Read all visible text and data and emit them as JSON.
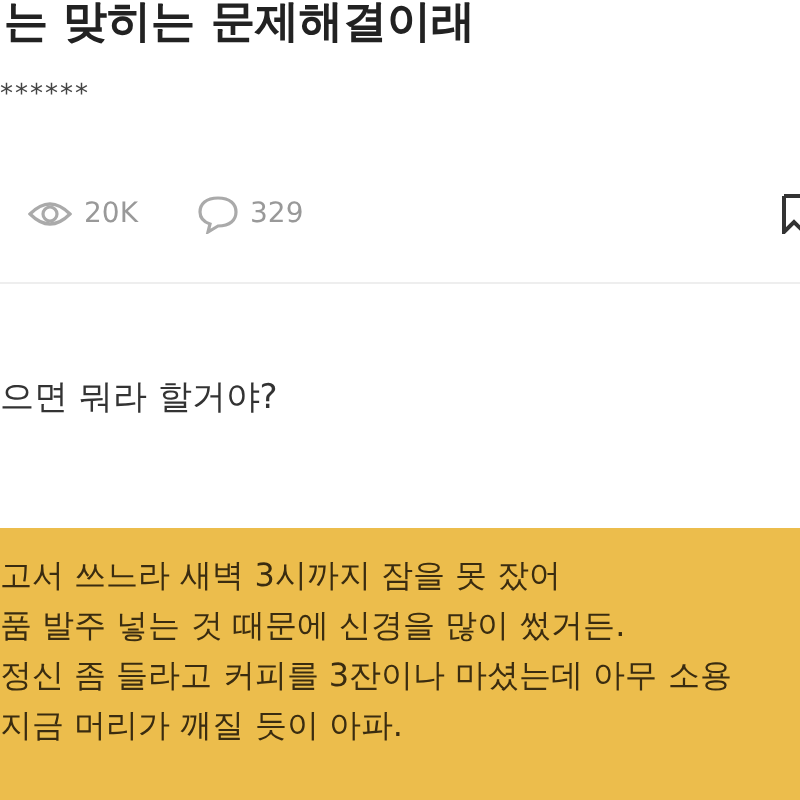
{
  "post": {
    "title": "는 맞히는 문제해결이래",
    "author": "******",
    "views": "20K",
    "comments": "329"
  },
  "question": "으면 뭐라 할거야?",
  "note": {
    "lines": [
      "고서 쓰느라 새벽 3시까지 잠을 못 잤어",
      "품 발주 넣는 것 때문에 신경을 많이 썼거든.",
      "정신 좀 들라고 커피를 3잔이나 마셨는데 아무 소용",
      "지금 머리가 깨질 듯이 아파."
    ]
  }
}
